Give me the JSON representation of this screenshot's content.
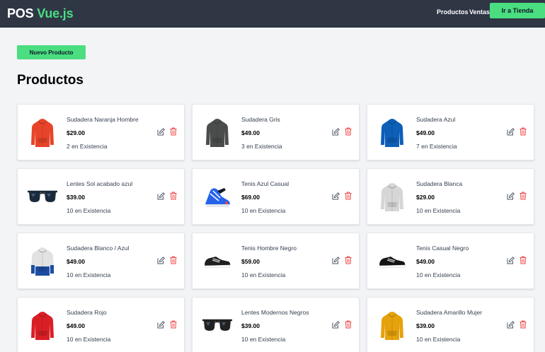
{
  "nav": {
    "brand_first": "POS",
    "brand_second": "Vue.js",
    "links": [
      "Productos",
      "Ventas"
    ],
    "store_button": "Ir a Tienda"
  },
  "new_product_button": "Nuevo Producto",
  "page_title": "Productos",
  "colors": {
    "accent": "#4ade80",
    "navbar": "#2f3745",
    "delete": "#ef4444",
    "background": "#f3f4f6"
  },
  "products": [
    {
      "name": "Sudadera Naranja Hombre",
      "price": "$29.00",
      "stock": "2 en Existencia",
      "kind": "hoodie",
      "color": "#e8442a",
      "icon": "orange-hoodie-icon"
    },
    {
      "name": "Sudadera Gris",
      "price": "$49.00",
      "stock": "3 en Existencia",
      "kind": "hoodie",
      "color": "#4b4d4c",
      "icon": "gray-hoodie-icon"
    },
    {
      "name": "Sudadera Azul",
      "price": "$49.00",
      "stock": "7 en Existencia",
      "kind": "hoodie",
      "color": "#0d5fb8",
      "icon": "blue-hoodie-icon"
    },
    {
      "name": "Lentes Sol acabado azul",
      "price": "$39.00",
      "stock": "10 en Existencia",
      "kind": "glasses",
      "color": "#1b2a3a",
      "icon": "sunglasses-icon"
    },
    {
      "name": "Tenis Azul Casual",
      "price": "$69.00",
      "stock": "10 en Existencia",
      "kind": "shoe-blue",
      "color": "#2563eb",
      "icon": "blue-sneaker-icon"
    },
    {
      "name": "Sudadera Blanca",
      "price": "$29.00",
      "stock": "10 en Existencia",
      "kind": "hoodie",
      "color": "#d6d6d6",
      "icon": "white-hoodie-icon"
    },
    {
      "name": "Sudadera Blanco / Azul",
      "price": "$49.00",
      "stock": "10 en Existencia",
      "kind": "hoodie-two",
      "color": "#1d4ea3",
      "icon": "white-blue-hoodie-icon"
    },
    {
      "name": "Tenis Hombre Negro",
      "price": "$59.00",
      "stock": "10 en Existencia",
      "kind": "shoe",
      "color": "#1f1f1f",
      "icon": "black-sneaker-icon"
    },
    {
      "name": "Tenis Casual Negro",
      "price": "$49.00",
      "stock": "10 en Existencia",
      "kind": "shoe",
      "color": "#141414",
      "icon": "black-casual-sneaker-icon"
    },
    {
      "name": "Sudadera Rojo",
      "price": "$49.00",
      "stock": "10 en Existencia",
      "kind": "hoodie",
      "color": "#d91f25",
      "icon": "red-hoodie-icon"
    },
    {
      "name": "Lentes Modernos Negros",
      "price": "$39.00",
      "stock": "10 en Existencia",
      "kind": "glasses",
      "color": "#222222",
      "icon": "black-glasses-icon"
    },
    {
      "name": "Sudadera Amarillo Mujer",
      "price": "$39.00",
      "stock": "10 en Existencia",
      "kind": "hoodie",
      "color": "#e5a20c",
      "icon": "yellow-hoodie-icon"
    }
  ]
}
